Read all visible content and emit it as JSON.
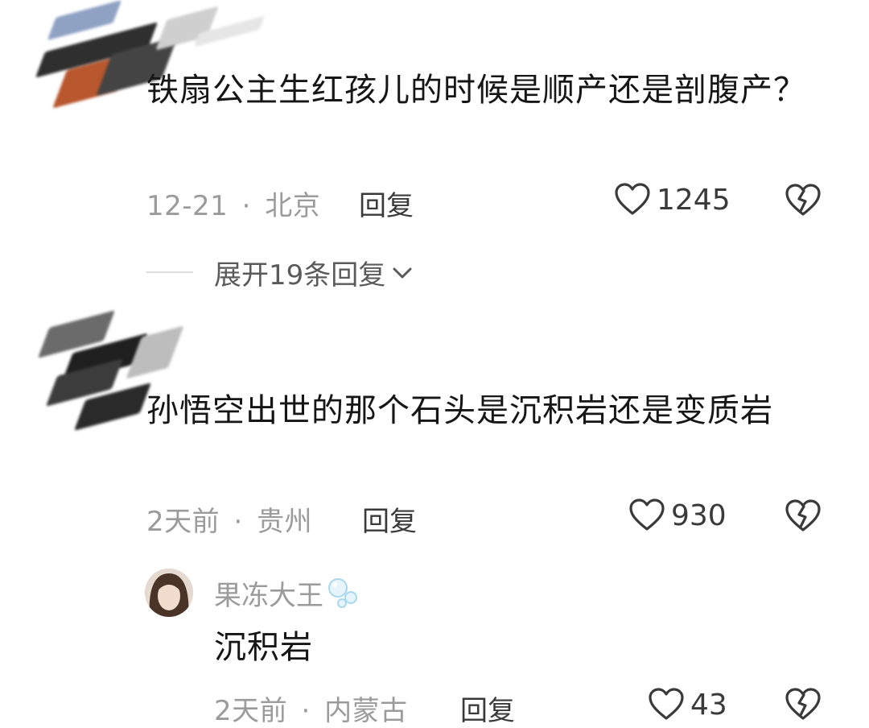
{
  "comments": [
    {
      "text": "铁扇公主生红孩儿的时候是顺产还是剖腹产？",
      "date": "12-21",
      "location": "北京",
      "reply_label": "回复",
      "likes": "1245",
      "expand_label": "展开19条回复"
    },
    {
      "text": "孙悟空出世的那个石头是沉积岩还是变质岩",
      "date": "2天前",
      "location": "贵州",
      "reply_label": "回复",
      "likes": "930",
      "reply": {
        "username": "果冻大王",
        "text": "沉积岩",
        "date": "2天前",
        "location": "内蒙古",
        "reply_label": "回复",
        "likes": "43"
      }
    }
  ],
  "separator": "·",
  "icons": {
    "like": "heart-outline-icon",
    "dislike": "broken-heart-icon",
    "expand": "chevron-down-icon",
    "badge": "bubbles-icon"
  },
  "colors": {
    "meta_gray": "#9b9b9b",
    "text_dark": "#161616",
    "action_dark": "#3a3a3a"
  }
}
